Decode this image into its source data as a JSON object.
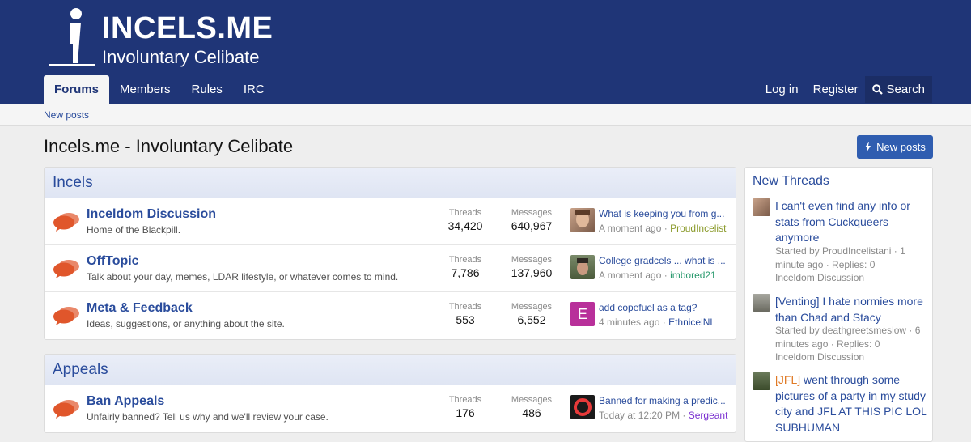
{
  "header": {
    "logo_title": "INCELS.ME",
    "logo_subtitle": "Involuntary Celibate",
    "nav_tabs": [
      {
        "label": "Forums",
        "active": true
      },
      {
        "label": "Members"
      },
      {
        "label": "Rules"
      },
      {
        "label": "IRC"
      }
    ],
    "login_label": "Log in",
    "register_label": "Register",
    "search_label": "Search",
    "search_icon": "search-icon"
  },
  "subnav": {
    "new_posts_link": "New posts"
  },
  "page": {
    "title": "Incels.me - Involuntary Celibate",
    "new_posts_button": "New posts"
  },
  "categories": [
    {
      "title": "Incels",
      "forums": [
        {
          "title": "Inceldom Discussion",
          "description": "Home of the Blackpill.",
          "threads_label": "Threads",
          "threads": "34,420",
          "messages_label": "Messages",
          "messages": "640,967",
          "last_title": "What is keeping you from g...",
          "last_time": "A moment ago",
          "last_user": "ProudIncelist",
          "user_color": "#8a9a2a"
        },
        {
          "title": "OffTopic",
          "description": "Talk about your day, memes, LDAR lifestyle, or whatever comes to mind.",
          "threads_label": "Threads",
          "threads": "7,786",
          "messages_label": "Messages",
          "messages": "137,960",
          "last_title": "College gradcels ... what is ...",
          "last_time": "A moment ago",
          "last_user": "imbored21",
          "user_color": "#2a9a6e"
        },
        {
          "title": "Meta & Feedback",
          "description": "Ideas, suggestions, or anything about the site.",
          "threads_label": "Threads",
          "threads": "553",
          "messages_label": "Messages",
          "messages": "6,552",
          "last_title": "add copefuel as a tag?",
          "last_time": "4 minutes ago",
          "last_user": "EthnicelNL",
          "user_color": "#2a4c9c",
          "avatar_letter": "E"
        }
      ]
    },
    {
      "title": "Appeals",
      "forums": [
        {
          "title": "Ban Appeals",
          "description": "Unfairly banned? Tell us why and we'll review your case.",
          "threads_label": "Threads",
          "threads": "176",
          "messages_label": "Messages",
          "messages": "486",
          "last_title": "Banned for making a predic...",
          "last_time": "Today at 12:20 PM",
          "last_user": "Sergeant",
          "user_color": "#7a2fd0"
        }
      ]
    }
  ],
  "sidebar": {
    "title": "New Threads",
    "items": [
      {
        "title": "I can't even find any info or stats from Cuckqueers anymore",
        "meta": "Started by ProudIncelistani · 1 minute ago · Replies: 0",
        "forum": "Inceldom Discussion"
      },
      {
        "title": "[Venting] I hate normies more than Chad and Stacy",
        "meta": "Started by deathgreetsmeslow · 6 minutes ago · Replies: 0",
        "forum": "Inceldom Discussion"
      },
      {
        "prefix": "[JFL]",
        "title": " went through some pictures of a party in my study city and JFL AT THIS PIC LOL SUBHUMAN"
      }
    ]
  },
  "colors": {
    "header_bg": "#1f3577",
    "link": "#2a4c9c",
    "button": "#2f5db0",
    "node_icon": "#e0562b"
  }
}
